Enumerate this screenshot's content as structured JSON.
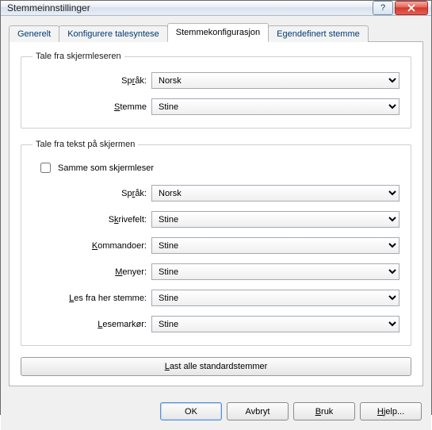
{
  "window": {
    "title": "Stemmeinnstillinger"
  },
  "tabs": [
    {
      "label": "Generelt"
    },
    {
      "label": "Konfigurere talesyntese"
    },
    {
      "label": "Stemmekonfigurasjon"
    },
    {
      "label": "Egendefinert stemme"
    }
  ],
  "group1": {
    "legend": "Tale fra skjermleseren",
    "language_label_pre": "Sp",
    "language_label_u": "r",
    "language_label_post": "åk:",
    "language_value": "Norsk",
    "voice_label_u": "S",
    "voice_label_post": "temme",
    "voice_value": "Stine"
  },
  "group2": {
    "legend_u": "T",
    "legend_post": "ale fra tekst på skjermen",
    "checkbox_label": "Samme som skjermleser",
    "language_label_pre": "Sp",
    "language_label_u": "r",
    "language_label_post": "åk:",
    "language_value": "Norsk",
    "writefield_label_pre": "S",
    "writefield_label_u": "k",
    "writefield_label_post": "rivefelt:",
    "writefield_value": "Stine",
    "commands_label_u": "K",
    "commands_label_post": "ommandoer:",
    "commands_value": "Stine",
    "menus_label_u": "M",
    "menus_label_post": "enyer:",
    "menus_value": "Stine",
    "readfrom_label_u": "L",
    "readfrom_label_post": "es fra her stemme:",
    "readfrom_value": "Stine",
    "cursor_label_u": "L",
    "cursor_label_post": "esemarkør:",
    "cursor_value": "Stine"
  },
  "load_button_u": "L",
  "load_button_post": "ast alle standardstemmer",
  "footer": {
    "ok": "OK",
    "cancel": "Avbryt",
    "apply_u": "B",
    "apply_post": "ruk",
    "help_u": "H",
    "help_post": "jelp..."
  }
}
